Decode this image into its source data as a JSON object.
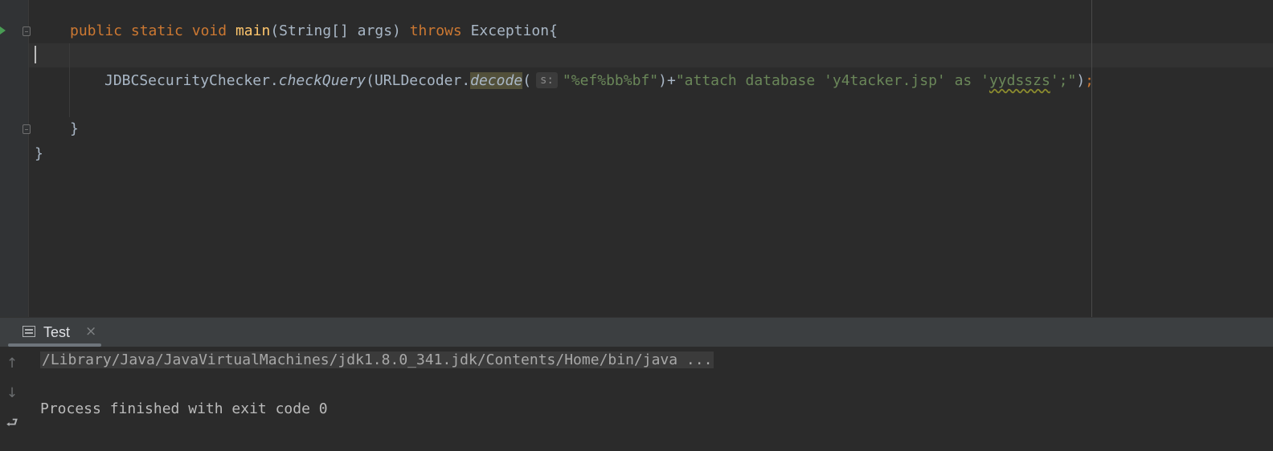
{
  "editor": {
    "line_main": {
      "kw_public": "public",
      "kw_static": "static",
      "kw_void": "void",
      "method": "main",
      "params": "(String[] args) ",
      "kw_throws": "throws",
      "exception": " Exception{"
    },
    "line_call": {
      "class_name": "JDBCSecurityChecker.",
      "method": "checkQuery",
      "open": "(URLDecoder.",
      "decode": "decode",
      "paren": "(",
      "param_hint": "s:",
      "str1": "\"%ef%bb%bf\"",
      "concat": ")+",
      "str2_prefix": "\"attach database 'y4tacker.jsp' as '",
      "str2_typo": "yydsszs",
      "str2_suffix": "';\"",
      "close": ")",
      "semicolon": ";"
    },
    "close_method": "}",
    "close_class": "}"
  },
  "run_panel": {
    "tab_label": "Test",
    "tab_close": "×",
    "command_line": "/Library/Java/JavaVirtualMachines/jdk1.8.0_341.jdk/Contents/Home/bin/java ...",
    "exit_message": "Process finished with exit code 0",
    "buttons": {
      "up": "↑",
      "down": "↓",
      "wrap": "⮐"
    }
  },
  "colors": {
    "keyword": "#cc7832",
    "method_decl": "#ffc66d",
    "string": "#6a8759",
    "text": "#a9b7c6",
    "background": "#2b2b2b"
  }
}
